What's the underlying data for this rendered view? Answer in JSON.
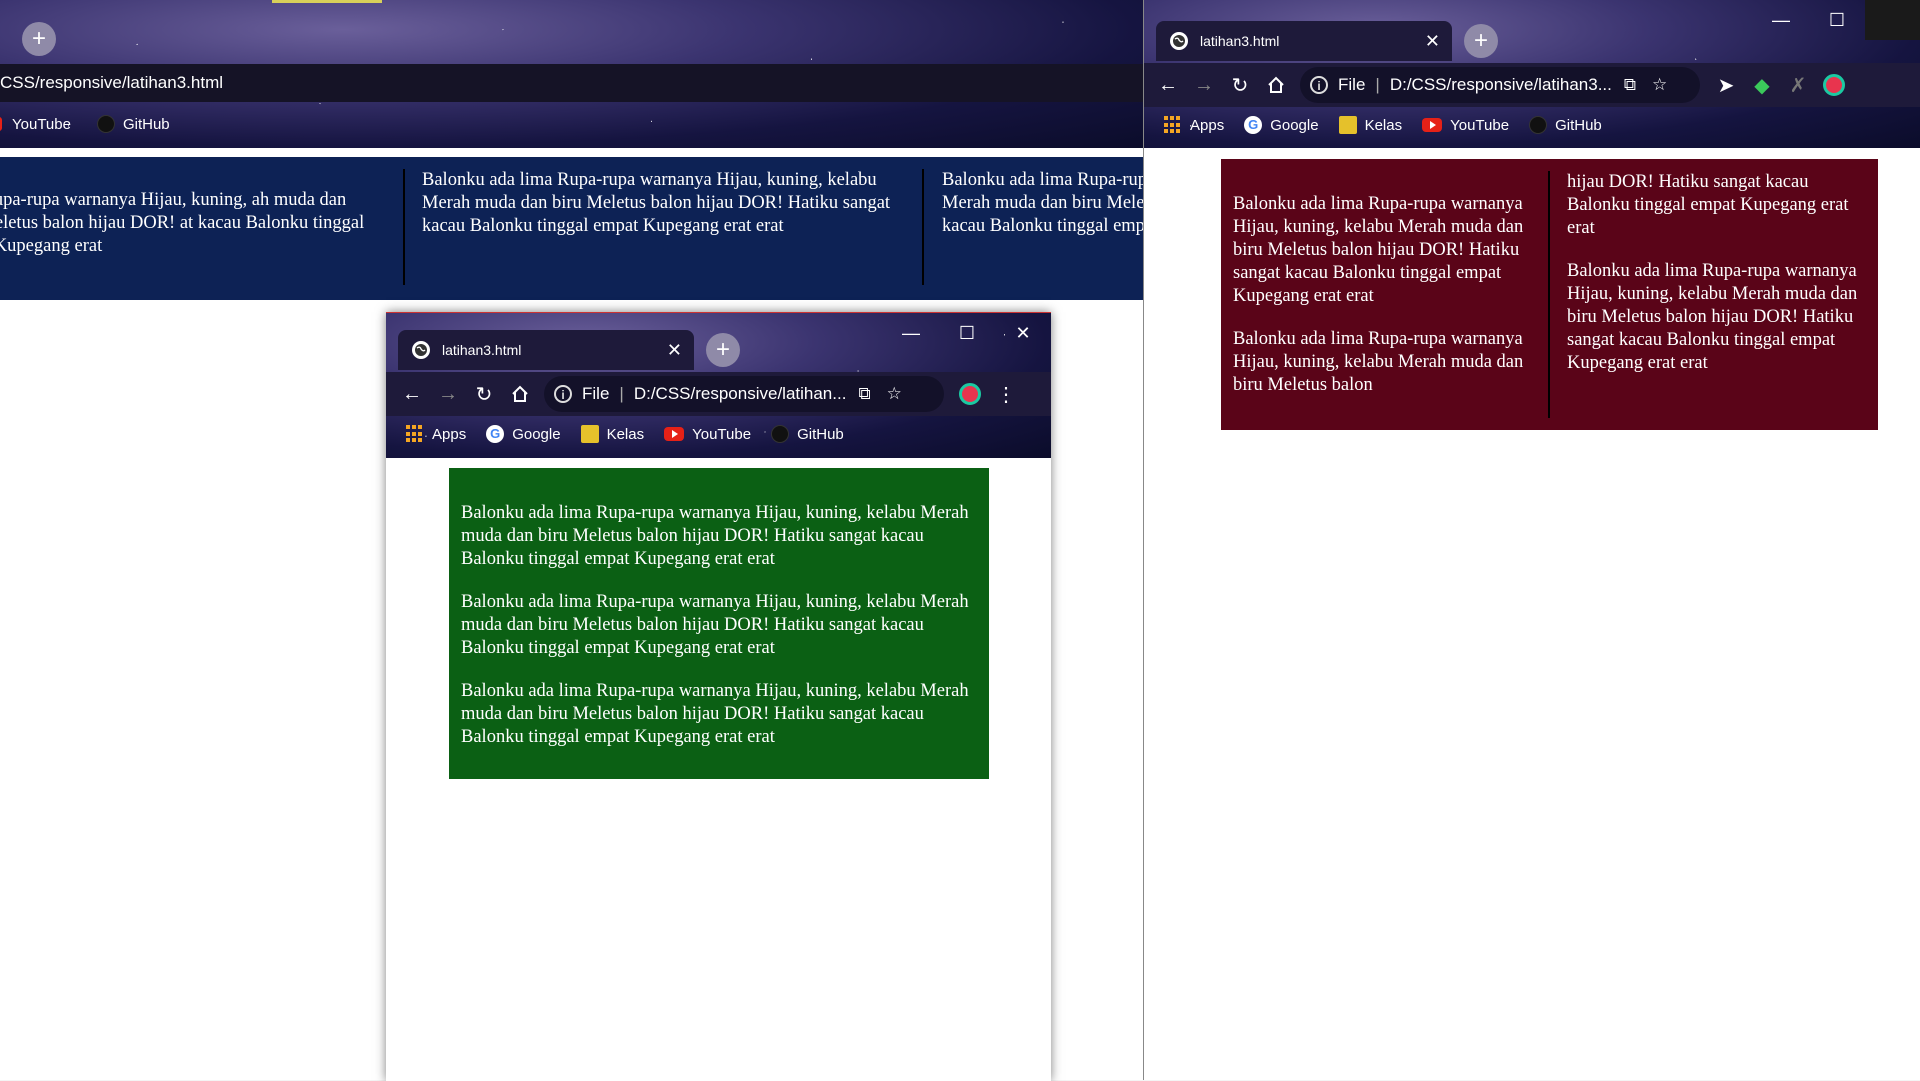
{
  "bg_window": {
    "address": "CSS/responsive/latihan3.html",
    "bookmarks": [
      "YouTube",
      "GitHub"
    ],
    "columns": [
      "lima Rupa-rupa warnanya Hijau, kuning, ah muda dan biru Meletus balon hijau DOR! at kacau Balonku tinggal empat Kupegang erat",
      "Balonku ada lima Rupa-rupa warnanya Hijau, kuning, kelabu Merah muda dan biru Meletus balon hijau DOR! Hatiku sangat kacau Balonku tinggal empat Kupegang erat erat",
      "Balonku ada lima Rupa-rupa warnanya Hijau, kuning, kelabu Merah muda dan biru Meletus balon hijau DOR! Hatiku sangat kacau Balonku tinggal empat Kupegang erat erat"
    ],
    "bg_color": "#0d2255"
  },
  "center_window": {
    "tab_title": "latihan3.html",
    "file_label": "File",
    "url": "D:/CSS/responsive/latihan...",
    "bookmarks": {
      "apps": "Apps",
      "google": "Google",
      "kelas": "Kelas",
      "youtube": "YouTube",
      "github": "GitHub"
    },
    "paragraphs": [
      "Balonku ada lima Rupa-rupa warnanya Hijau, kuning, kelabu Merah muda dan biru Meletus balon hijau DOR! Hatiku sangat kacau Balonku tinggal empat Kupegang erat erat",
      "Balonku ada lima Rupa-rupa warnanya Hijau, kuning, kelabu Merah muda dan biru Meletus balon hijau DOR! Hatiku sangat kacau Balonku tinggal empat Kupegang erat erat",
      "Balonku ada lima Rupa-rupa warnanya Hijau, kuning, kelabu Merah muda dan biru Meletus balon hijau DOR! Hatiku sangat kacau Balonku tinggal empat Kupegang erat erat"
    ],
    "box_color": "#0b6014"
  },
  "right_window": {
    "tab_title": "latihan3.html",
    "file_label": "File",
    "url": "D:/CSS/responsive/latihan3...",
    "bookmarks": {
      "apps": "Apps",
      "google": "Google",
      "kelas": "Kelas",
      "youtube": "YouTube",
      "github": "GitHub"
    },
    "col1": [
      "Balonku ada lima Rupa-rupa warnanya Hijau, kuning, kelabu Merah muda dan biru Meletus balon hijau DOR! Hatiku sangat kacau Balonku tinggal empat Kupegang erat erat",
      "Balonku ada lima Rupa-rupa warnanya Hijau, kuning, kelabu Merah muda dan biru Meletus balon"
    ],
    "col2": [
      "hijau DOR! Hatiku sangat kacau Balonku tinggal empat Kupegang erat erat",
      "Balonku ada lima Rupa-rupa warnanya Hijau, kuning, kelabu Merah muda dan biru Meletus balon hijau DOR! Hatiku sangat kacau Balonku tinggal empat Kupegang erat erat"
    ],
    "box_color": "#5a0418"
  },
  "window_controls": {
    "minimize": "—",
    "maximize": "☐",
    "close": "✕"
  }
}
